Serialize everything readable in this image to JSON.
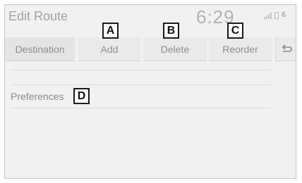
{
  "header": {
    "title": "Edit Route",
    "clock": "6:29"
  },
  "tabs": {
    "destination": "Destination",
    "add": "Add",
    "delete": "Delete",
    "reorder": "Reorder"
  },
  "preferences_label": "Preferences",
  "callouts": {
    "a": "A",
    "b": "B",
    "c": "C",
    "d": "D"
  },
  "icons": {
    "status": [
      "signal-icon",
      "phone-icon",
      "bluetooth-icon"
    ],
    "back": "back-arrow-icon"
  }
}
